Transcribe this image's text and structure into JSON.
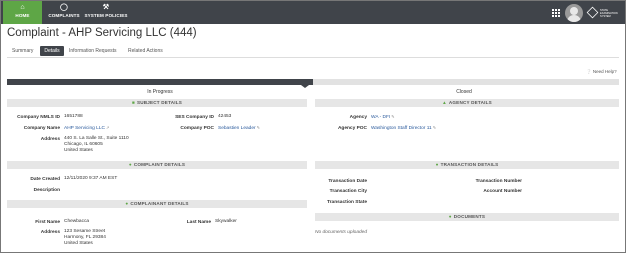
{
  "nav": {
    "items": [
      {
        "label": "HOME",
        "icon": "home-icon"
      },
      {
        "label": "COMPLAINTS",
        "icon": "chat-bubble-icon"
      },
      {
        "label": "SYSTEM POLICIES",
        "icon": "tools-icon"
      }
    ],
    "logo_text": "STATE EXAMINATION SYSTEM"
  },
  "page": {
    "title": "Complaint - AHP Servicing LLC (444)",
    "tabs": [
      "Summary",
      "Details",
      "Information Requests",
      "Related Actions"
    ],
    "active_tab": "Details",
    "need_help": "Need Help?"
  },
  "progress": {
    "stages": [
      "In Progress",
      "Closed"
    ],
    "current_stage": "In Progress",
    "fraction": 0.5
  },
  "subject": {
    "header": "SUBJECT DETAILS",
    "nmls_id_label": "Company NMLS ID",
    "nmls_id": "1651788",
    "ses_id_label": "SES Company ID",
    "ses_id": "42453",
    "company_name_label": "Company Name",
    "company_name": "AHP Servicing LLC",
    "company_poc_label": "Company POC",
    "company_poc": "Sebastien Leader",
    "address_label": "Address",
    "address_line1": "440 S. La Salle St., Suite 1110",
    "address_line2": "Chicago, IL 60605",
    "address_line3": "United States"
  },
  "agency": {
    "header": "AGENCY DETAILS",
    "agency_label": "Agency",
    "agency": "WA - DFI",
    "agency_poc_label": "Agency POC",
    "agency_poc": "Washington Staff Director 11"
  },
  "complaint": {
    "header": "COMPLAINT DETAILS",
    "date_created_label": "Date Created",
    "date_created": "12/11/2020 9:37 AM EST",
    "description_label": "Description",
    "description": ""
  },
  "transaction": {
    "header": "TRANSACTION DETAILS",
    "date_label": "Transaction Date",
    "number_label": "Transaction Number",
    "city_label": "Transaction City",
    "account_label": "Account Number",
    "state_label": "Transaction State"
  },
  "complainant": {
    "header": "COMPLAINANT DETAILS",
    "first_name_label": "First Name",
    "first_name": "Chewbacca",
    "last_name_label": "Last Name",
    "last_name": "Skywalker",
    "address_label": "Address",
    "address_line1": "123 Sesame Street",
    "address_line2": "Harmony, FL 29384",
    "address_line3": "United States"
  },
  "documents": {
    "header": "DOCUMENTS",
    "empty_text": "No documents uploaded"
  },
  "colors": {
    "nav_bg": "#40444a",
    "accent_green": "#5ea646",
    "link_blue": "#2a5a9c"
  }
}
